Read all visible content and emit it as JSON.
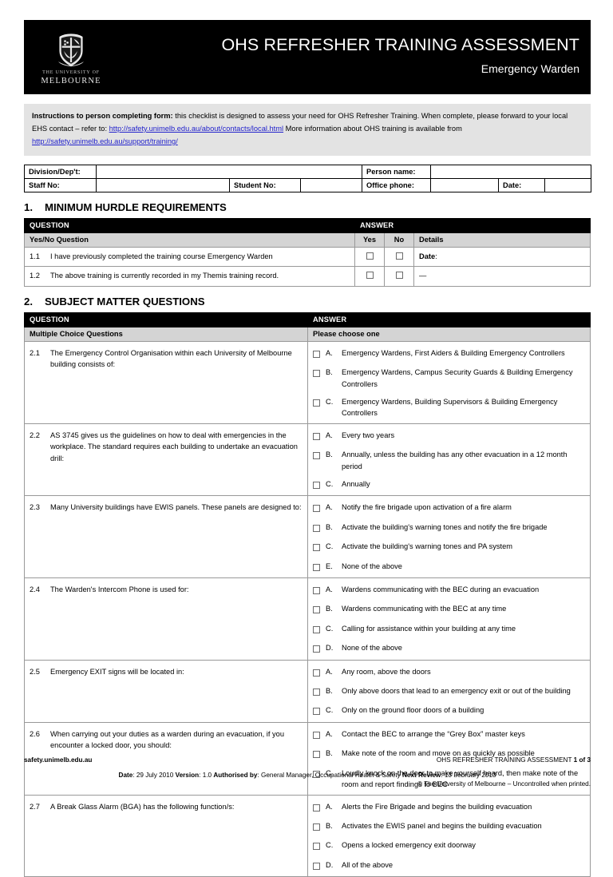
{
  "header": {
    "title": "OHS REFRESHER TRAINING ASSESSMENT",
    "subtitle": "Emergency Warden",
    "logo": {
      "line1": "THE UNIVERSITY OF",
      "line2": "MELBOURNE"
    },
    "background_color": "#000000",
    "text_color": "#ffffff"
  },
  "instructions": {
    "label": "Instructions to person completing form:",
    "text_part1": " this checklist is designed to assess your need for OHS Refresher Training. When complete, please forward to your local EHS contact – refer to: ",
    "link1": "http://safety.unimelb.edu.au/about/contacts/local.html",
    "text_part2": "  More information about OHS training is available from ",
    "link2": "http://safety.unimelb.edu.au/support/training/",
    "background_color": "#e3e3e3",
    "link_color": "#2222cc"
  },
  "form_fields": {
    "row1": [
      {
        "label": "Division/Dep't:",
        "value": ""
      },
      {
        "label": "Person name:",
        "value": ""
      }
    ],
    "row2": [
      {
        "label": "Staff No:",
        "value": ""
      },
      {
        "label": "Student No:",
        "value": ""
      },
      {
        "label": "Office phone:",
        "value": ""
      },
      {
        "label": "Date:",
        "value": ""
      }
    ]
  },
  "section1": {
    "number": "1.",
    "heading": "MINIMUM HURDLE REQUIREMENTS",
    "col_question": "QUESTION",
    "col_answer": "ANSWER",
    "sub_question": "Yes/No Question",
    "sub_yes": "Yes",
    "sub_no": "No",
    "sub_details": "Details",
    "rows": [
      {
        "num": "1.1",
        "text": "I have previously completed the training course Emergency Warden",
        "details_label": "Date",
        "details_suffix": ":"
      },
      {
        "num": "1.2",
        "text": "The above training is currently recorded in my Themis training record.",
        "details_label": "—",
        "details_suffix": ""
      }
    ]
  },
  "section2": {
    "number": "2.",
    "heading": "SUBJECT MATTER QUESTIONS",
    "col_question": "QUESTION",
    "col_answer": "ANSWER",
    "sub_question": "Multiple Choice Questions",
    "sub_answer": "Please choose one",
    "questions": [
      {
        "num": "2.1",
        "text": "The Emergency Control Organisation within each University of Melbourne building consists of:",
        "options": [
          {
            "letter": "A.",
            "text": "Emergency Wardens, First Aiders & Building Emergency Controllers"
          },
          {
            "letter": "B.",
            "text": "Emergency Wardens, Campus Security Guards & Building Emergency Controllers"
          },
          {
            "letter": "C.",
            "text": "Emergency Wardens, Building Supervisors & Building Emergency Controllers"
          }
        ]
      },
      {
        "num": "2.2",
        "text": "AS 3745 gives us the guidelines on how to deal with emergencies in the workplace.  The standard requires each building to undertake an evacuation drill:",
        "options": [
          {
            "letter": "A.",
            "text": "Every two years"
          },
          {
            "letter": "B.",
            "text": "Annually, unless the building has any other evacuation in a 12 month period"
          },
          {
            "letter": "C.",
            "text": "Annually"
          }
        ]
      },
      {
        "num": "2.3",
        "text": "Many University buildings have EWIS panels.  These panels are designed to:",
        "options": [
          {
            "letter": "A.",
            "text": "Notify the fire brigade upon activation of a fire alarm"
          },
          {
            "letter": "B.",
            "text": "Activate the building's warning tones and notify the fire brigade"
          },
          {
            "letter": "C.",
            "text": "Activate the building's warning tones and PA system"
          },
          {
            "letter": "E.",
            "text": "None of the above"
          }
        ]
      },
      {
        "num": "2.4",
        "text": "The Warden's Intercom Phone is used for:",
        "options": [
          {
            "letter": "A.",
            "text": "Wardens communicating with the BEC during an evacuation"
          },
          {
            "letter": "B.",
            "text": "Wardens communicating with the BEC at any time"
          },
          {
            "letter": "C.",
            "text": "Calling for assistance within your building at any time"
          },
          {
            "letter": "D.",
            "text": "None of the above"
          }
        ]
      },
      {
        "num": "2.5",
        "text": "Emergency EXIT signs will be located in:",
        "options": [
          {
            "letter": "A.",
            "text": "Any room, above the doors"
          },
          {
            "letter": "B.",
            "text": "Only above doors that lead to an emergency exit or out of the building"
          },
          {
            "letter": "C.",
            "text": "Only on the ground floor doors of a building"
          }
        ]
      },
      {
        "num": "2.6",
        "text": "When carrying out your duties as a warden during an evacuation, if you encounter a locked door, you should:",
        "options": [
          {
            "letter": "A.",
            "text": "Contact the BEC to arrange the “Grey Box” master keys"
          },
          {
            "letter": "B.",
            "text": "Make note of the room and move on as quickly as possible"
          },
          {
            "letter": "C.",
            "text": "Loudly knock on the door to make yourself heard, then make note of the room and report findings to BEC"
          }
        ]
      },
      {
        "num": "2.7",
        "text": "A Break Glass Alarm (BGA) has the following function/s:",
        "options": [
          {
            "letter": "A.",
            "text": "Alerts the Fire Brigade and begins the building evacuation"
          },
          {
            "letter": "B.",
            "text": "Activates the EWIS panel and begins the building evacuation"
          },
          {
            "letter": "C.",
            "text": "Opens a locked emergency exit doorway"
          },
          {
            "letter": "D.",
            "text": "All of the above"
          }
        ]
      }
    ]
  },
  "footer": {
    "website": "safety.unimelb.edu.au",
    "doc_name": "OHS REFRESHER TRAINING ASSESSMENT",
    "page_label": "1 of 3",
    "date_label": "Date",
    "date_value": ": 29 July 2010  ",
    "version_label": "Version",
    "version_value": ": 1.0 ",
    "authorised_label": "Authorised by",
    "authorised_value": ": General Manager, Occupational Health & Safety ",
    "next_review_label": "Next Review",
    "next_review_value": ": 13 February 2013",
    "copyright": "© The University of Melbourne – Uncontrolled when printed."
  }
}
